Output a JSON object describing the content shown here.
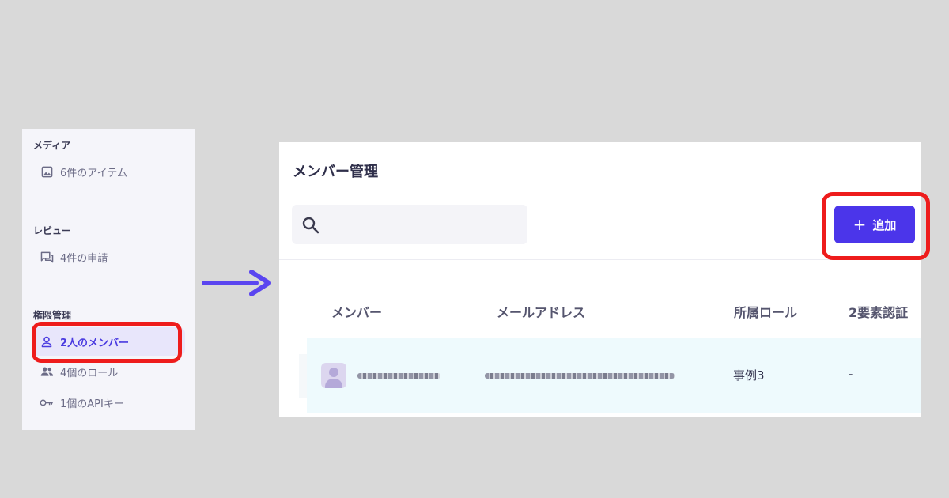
{
  "sidebar": {
    "sections": [
      {
        "label": "メディア",
        "items": [
          {
            "label": "6件のアイテム",
            "icon": "image-icon"
          }
        ]
      },
      {
        "label": "レビュー",
        "items": [
          {
            "label": "4件の申請",
            "icon": "chat-icon"
          }
        ]
      },
      {
        "label": "権限管理",
        "items": [
          {
            "label": "2人のメンバー",
            "icon": "user-icon",
            "active": true
          },
          {
            "label": "4個のロール",
            "icon": "users-icon"
          },
          {
            "label": "1個のAPIキー",
            "icon": "key-icon"
          }
        ]
      }
    ]
  },
  "main": {
    "title": "メンバー管理",
    "search": {
      "placeholder": "",
      "value": ""
    },
    "add_button": {
      "icon": "+",
      "label": "追加"
    },
    "table": {
      "columns": [
        "メンバー",
        "メールアドレス",
        "所属ロール",
        "2要素認証"
      ],
      "rows": [
        {
          "member": "",
          "email": "",
          "role": "事例3",
          "two_factor": "-"
        }
      ]
    }
  },
  "colors": {
    "accent": "#4b35ea",
    "highlight": "#ee1c1c",
    "arrow": "#5a45f0",
    "active_bg": "#e8e6fb",
    "row_bg": "#eefafd"
  }
}
